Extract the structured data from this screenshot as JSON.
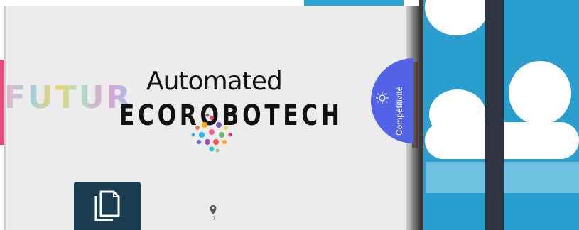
{
  "brand": {
    "futur_text": "FUTUR",
    "automated_text": "Automated",
    "ecorobotech_text": "ECOROBOTECH"
  },
  "competitivite": {
    "label": "Compétitivité",
    "icon": "lightbulb-icon"
  },
  "actions": {
    "documents_icon": "documents-icon",
    "location_icon": "location-pin-icon"
  },
  "colors": {
    "card_bg": "#ececec",
    "pill_blue": "#5263e8",
    "doc_btn": "#1a3d52",
    "right_teal": "#2a9fcf",
    "pink_tab": "#e94a7a"
  }
}
